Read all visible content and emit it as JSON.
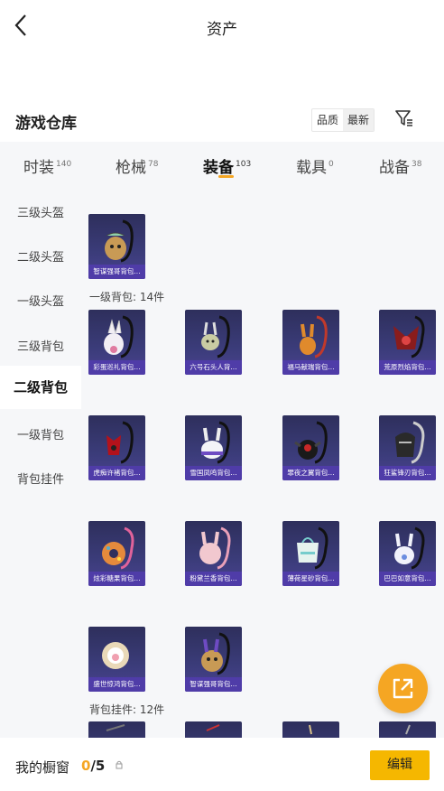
{
  "header": {
    "title": "资产",
    "back_icon": "chevron-left-icon"
  },
  "warehouse": {
    "title": "游戏仓库",
    "sort_options": [
      "品质",
      "最新"
    ],
    "filter_icon": "filter-icon"
  },
  "tabs": [
    {
      "label": "时装",
      "count": "140"
    },
    {
      "label": "枪械",
      "count": "78"
    },
    {
      "label": "装备",
      "count": "103",
      "active": true
    },
    {
      "label": "载具",
      "count": "0"
    },
    {
      "label": "战备",
      "count": "38"
    }
  ],
  "side_menu": [
    {
      "label": "三级头盔"
    },
    {
      "label": "二级头盔"
    },
    {
      "label": "一级头盔"
    },
    {
      "label": "三级背包"
    },
    {
      "label": "二级背包",
      "active": true
    },
    {
      "label": "一级背包"
    },
    {
      "label": "背包挂件"
    }
  ],
  "sections": {
    "top_item": "智谋强哥背包...",
    "level1_backpack": "一级背包: 14件",
    "items": [
      "彩蛋巡礼背包...",
      "六号石头人背...",
      "福马献瑞背包...",
      "荒原烈焰背包...",
      "虎痴许褚背包...",
      "雪国凤鸣背包...",
      "罪夜之翼背包...",
      "狂鲨锋刃背包...",
      "炫彩糖果背包...",
      "粉黛兰香背包...",
      "薄荷星砂背包...",
      "巴巴如意背包...",
      "盛世惊鸿背包...",
      "智谋强哥背包..."
    ],
    "pendant": "背包挂件: 12件"
  },
  "bottom_bar": {
    "label": "我的橱窗",
    "count_current": "0",
    "count_total": "/5",
    "edit": "编辑"
  },
  "colors": {
    "accent": "#f5a623",
    "button": "#f5b700",
    "card_caption": "#5038aa"
  }
}
